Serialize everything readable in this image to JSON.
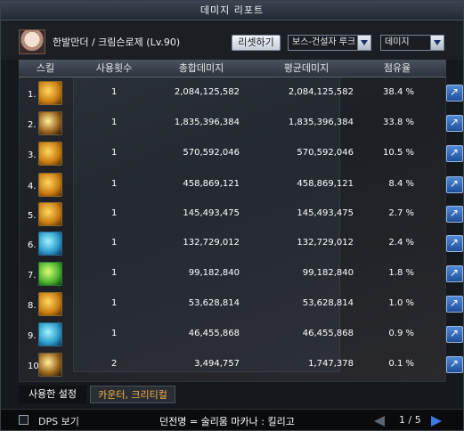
{
  "window": {
    "title": "데미지 리포트"
  },
  "header": {
    "character": "한발만더 / 크림슨로제 (Lv.90)",
    "reset_label": "리셋하기",
    "boss_select": "보스-건설자 루크",
    "type_select": "데미지"
  },
  "columns": {
    "skill": "스킬",
    "uses": "사용횟수",
    "total": "총합데미지",
    "avg": "평균데미지",
    "share": "점유율"
  },
  "rows": [
    {
      "rank": "1.",
      "uses": "1",
      "total": "2,084,125,582",
      "avg": "2,084,125,582",
      "pct": "38.4 %",
      "icon": "skill-icon-1"
    },
    {
      "rank": "2.",
      "uses": "1",
      "total": "1,835,396,384",
      "avg": "1,835,396,384",
      "pct": "33.8 %",
      "icon": "skill-icon-2"
    },
    {
      "rank": "3.",
      "uses": "1",
      "total": "570,592,046",
      "avg": "570,592,046",
      "pct": "10.5 %",
      "icon": "skill-icon-3"
    },
    {
      "rank": "4.",
      "uses": "1",
      "total": "458,869,121",
      "avg": "458,869,121",
      "pct": "8.4 %",
      "icon": "skill-icon-4"
    },
    {
      "rank": "5.",
      "uses": "1",
      "total": "145,493,475",
      "avg": "145,493,475",
      "pct": "2.7 %",
      "icon": "skill-icon-5"
    },
    {
      "rank": "6.",
      "uses": "1",
      "total": "132,729,012",
      "avg": "132,729,012",
      "pct": "2.4 %",
      "icon": "skill-icon-6"
    },
    {
      "rank": "7.",
      "uses": "1",
      "total": "99,182,840",
      "avg": "99,182,840",
      "pct": "1.8 %",
      "icon": "skill-icon-7"
    },
    {
      "rank": "8.",
      "uses": "1",
      "total": "53,628,814",
      "avg": "53,628,814",
      "pct": "1.0 %",
      "icon": "skill-icon-8"
    },
    {
      "rank": "9.",
      "uses": "1",
      "total": "46,455,868",
      "avg": "46,455,868",
      "pct": "0.9 %",
      "icon": "skill-icon-9"
    },
    {
      "rank": "10.",
      "uses": "2",
      "total": "3,494,757",
      "avg": "1,747,378",
      "pct": "0.1 %",
      "icon": "skill-icon-10"
    }
  ],
  "tabs": {
    "used": "사용한 설정",
    "counter": "카운터, 크리티컬"
  },
  "footer": {
    "dps_label": "DPS 보기",
    "dungeon": "던전명 = 술리움 마카나 : 킬리고",
    "page": "1 / 5"
  }
}
